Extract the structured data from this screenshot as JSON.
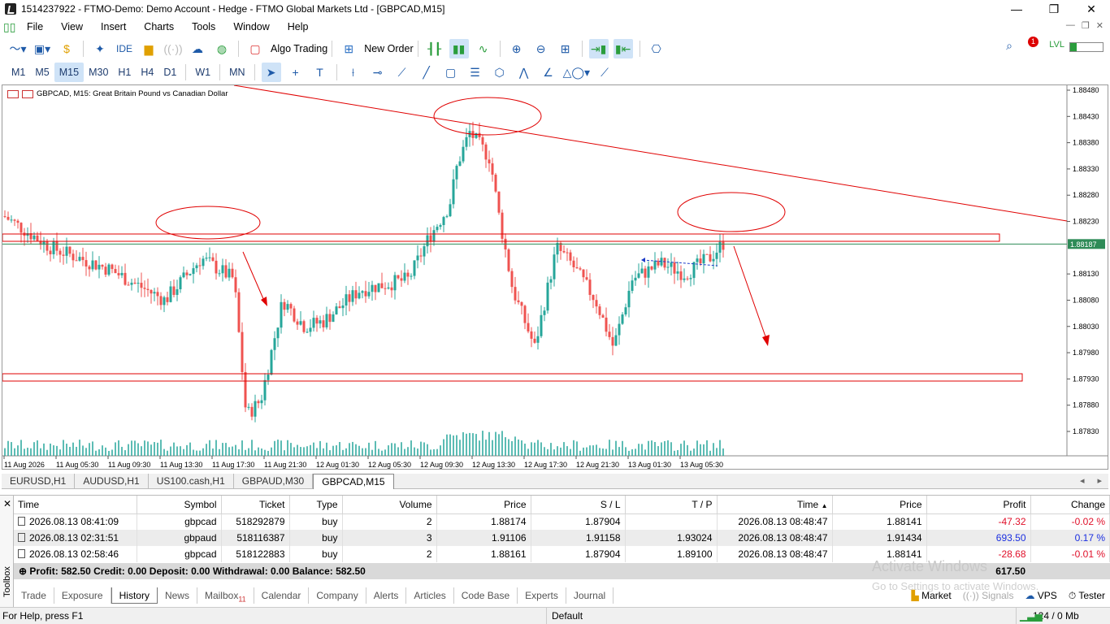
{
  "window": {
    "title": "1514237922 - FTMO-Demo: Demo Account - Hedge - FTMO Global Markets Ltd - [GBPCAD,M15]",
    "controls": [
      "—",
      "❐",
      "✕"
    ]
  },
  "menu": [
    "File",
    "View",
    "Insert",
    "Charts",
    "Tools",
    "Window",
    "Help"
  ],
  "toolbar": {
    "ide_label": "IDE",
    "algo_label": "Algo Trading",
    "neworder_label": "New Order",
    "notification_count": "1"
  },
  "timeframes": [
    "M1",
    "M5",
    "M15",
    "M30",
    "H1",
    "H4",
    "D1",
    "W1",
    "MN"
  ],
  "active_timeframe": "M15",
  "chart": {
    "label": "GBPCAD, M15:  Great Britain Pound vs Canadian Dollar",
    "current_price": "1.88187",
    "price_ticks": [
      "1.88480",
      "1.88430",
      "1.88380",
      "1.88330",
      "1.88280",
      "1.88230",
      "1.88130",
      "1.88080",
      "1.88030",
      "1.87980",
      "1.87930",
      "1.87880",
      "1.87830"
    ],
    "time_ticks": [
      "11 Aug 2026",
      "11 Aug 05:30",
      "11 Aug 09:30",
      "11 Aug 13:30",
      "11 Aug 17:30",
      "11 Aug 21:30",
      "12 Aug 01:30",
      "12 Aug 05:30",
      "12 Aug 09:30",
      "12 Aug 13:30",
      "12 Aug 17:30",
      "12 Aug 21:30",
      "13 Aug 01:30",
      "13 Aug 05:30"
    ],
    "colors": {
      "bull": "#26a69a",
      "bear": "#ef5350",
      "drawing": "#e00000",
      "price_line": "#2e8b57",
      "grid": "#e8e8e8"
    }
  },
  "chart_tabs": [
    "EURUSD,H1",
    "AUDUSD,H1",
    "US100.cash,H1",
    "GBPAUD,M30",
    "GBPCAD,M15"
  ],
  "active_chart_tab": "GBPCAD,M15",
  "history": {
    "columns": [
      "Time",
      "Symbol",
      "Ticket",
      "Type",
      "Volume",
      "Price",
      "S / L",
      "T / P",
      "Time",
      "Price",
      "Profit",
      "Change"
    ],
    "rows": [
      {
        "time": "2026.08.13 08:41:09",
        "symbol": "gbpcad",
        "ticket": "518292879",
        "type": "buy",
        "volume": "2",
        "price": "1.88174",
        "sl": "1.87904",
        "tp": "",
        "time2": "2026.08.13 08:48:47",
        "price2": "1.88141",
        "profit": "-47.32",
        "change": "-0.02 %"
      },
      {
        "time": "2026.08.13 02:31:51",
        "symbol": "gbpaud",
        "ticket": "518116387",
        "type": "buy",
        "volume": "3",
        "price": "1.91106",
        "sl": "1.91158",
        "tp": "1.93024",
        "time2": "2026.08.13 08:48:47",
        "price2": "1.91434",
        "profit": "693.50",
        "change": "0.17 %"
      },
      {
        "time": "2026.08.13 02:58:46",
        "symbol": "gbpcad",
        "ticket": "518122883",
        "type": "buy",
        "volume": "2",
        "price": "1.88161",
        "sl": "1.87904",
        "tp": "1.89100",
        "time2": "2026.08.13 08:48:47",
        "price2": "1.88141",
        "profit": "-28.68",
        "change": "-0.01 %"
      }
    ],
    "summary": "Profit: 582.50  Credit: 0.00  Deposit: 0.00  Withdrawal: 0.00  Balance: 582.50",
    "summary_value": "617.50"
  },
  "toolbox_label": "Toolbox",
  "bottom_tabs": [
    {
      "label": "Trade",
      "badge": ""
    },
    {
      "label": "Exposure",
      "badge": ""
    },
    {
      "label": "History",
      "badge": ""
    },
    {
      "label": "News",
      "badge": ""
    },
    {
      "label": "Mailbox",
      "badge": "11"
    },
    {
      "label": "Calendar",
      "badge": ""
    },
    {
      "label": "Company",
      "badge": ""
    },
    {
      "label": "Alerts",
      "badge": ""
    },
    {
      "label": "Articles",
      "badge": ""
    },
    {
      "label": "Code Base",
      "badge": ""
    },
    {
      "label": "Experts",
      "badge": ""
    },
    {
      "label": "Journal",
      "badge": ""
    }
  ],
  "active_bottom_tab": "History",
  "right_tabs": [
    "Market",
    "Signals",
    "VPS",
    "Tester"
  ],
  "watermark": {
    "line1": "Activate Windows",
    "line2": "Go to Settings to activate Windows."
  },
  "status": {
    "help": "For Help, press F1",
    "profile": "Default",
    "traffic": "124 / 0 Mb"
  }
}
